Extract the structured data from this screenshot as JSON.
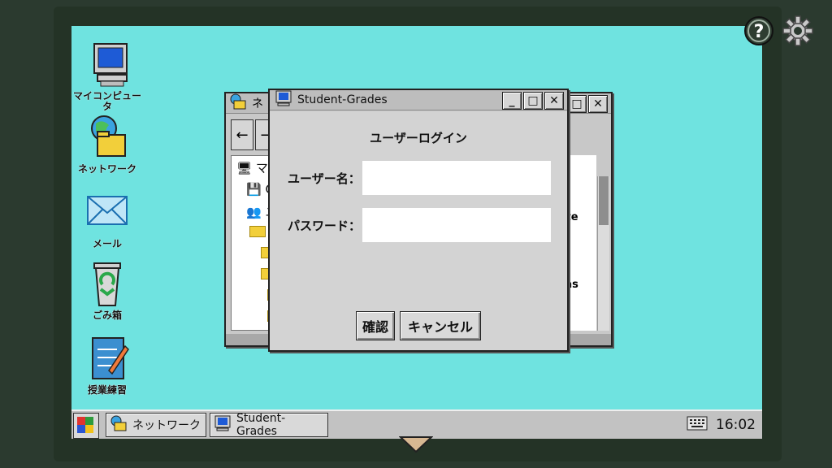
{
  "desktop": {
    "icons": [
      {
        "label": "マイコンピュー\nタ"
      },
      {
        "label": "ネットワーク"
      },
      {
        "label": "メール"
      },
      {
        "label": "ごみ箱"
      },
      {
        "label": "授業練習"
      }
    ]
  },
  "network_window": {
    "title": "ネ",
    "tree": [
      "マ",
      "C:",
      "ユ"
    ],
    "files": [
      "rInte\nd",
      "yNas"
    ]
  },
  "login_dialog": {
    "title": "Student-Grades",
    "heading": "ユーザーログイン",
    "username_label": "ユーザー名：",
    "username_value": "",
    "password_label": "パスワード：",
    "password_value": "",
    "confirm_label": "確認",
    "cancel_label": "キャンセル"
  },
  "taskbar": {
    "items": [
      {
        "label": "ネットワーク"
      },
      {
        "label": "Student-Grades"
      }
    ],
    "clock": "16:02"
  },
  "colors": {
    "desktop": "#6fe3e0",
    "window": "#d3d3d3",
    "frame": "#243326"
  }
}
